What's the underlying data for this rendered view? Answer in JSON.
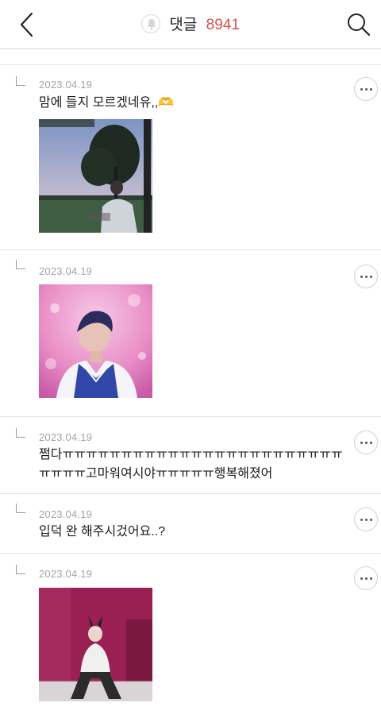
{
  "header": {
    "title": "댓글",
    "count": "8941",
    "count_color": "#d4554a",
    "back_icon": "chevron-left-icon",
    "search_icon": "search-icon",
    "bell_icon": "bell-icon"
  },
  "comments": [
    {
      "date": "2023.04.19",
      "text": "맘에 들지 모르겠네유,,🫶",
      "has_image": true,
      "image": "photo-evening-field"
    },
    {
      "date": "2023.04.19",
      "text": "",
      "has_image": true,
      "image": "photo-pink-stage"
    },
    {
      "date": "2023.04.19",
      "text": "쩜다ㅠㅠㅠㅠㅠㅠㅠㅠㅠㅠㅠㅠㅠㅠㅠㅠㅠㅠㅠㅠㅠㅠㅠㅠㅠㅠㅠㅠ고마워여시야ㅠㅠㅠㅠㅠ행복해졌어",
      "has_image": false
    },
    {
      "date": "2023.04.19",
      "text": "입덕 완 해주시겄어요..?",
      "has_image": false
    },
    {
      "date": "2023.04.19",
      "text": "",
      "has_image": true,
      "image": "photo-magenta-wall"
    }
  ]
}
